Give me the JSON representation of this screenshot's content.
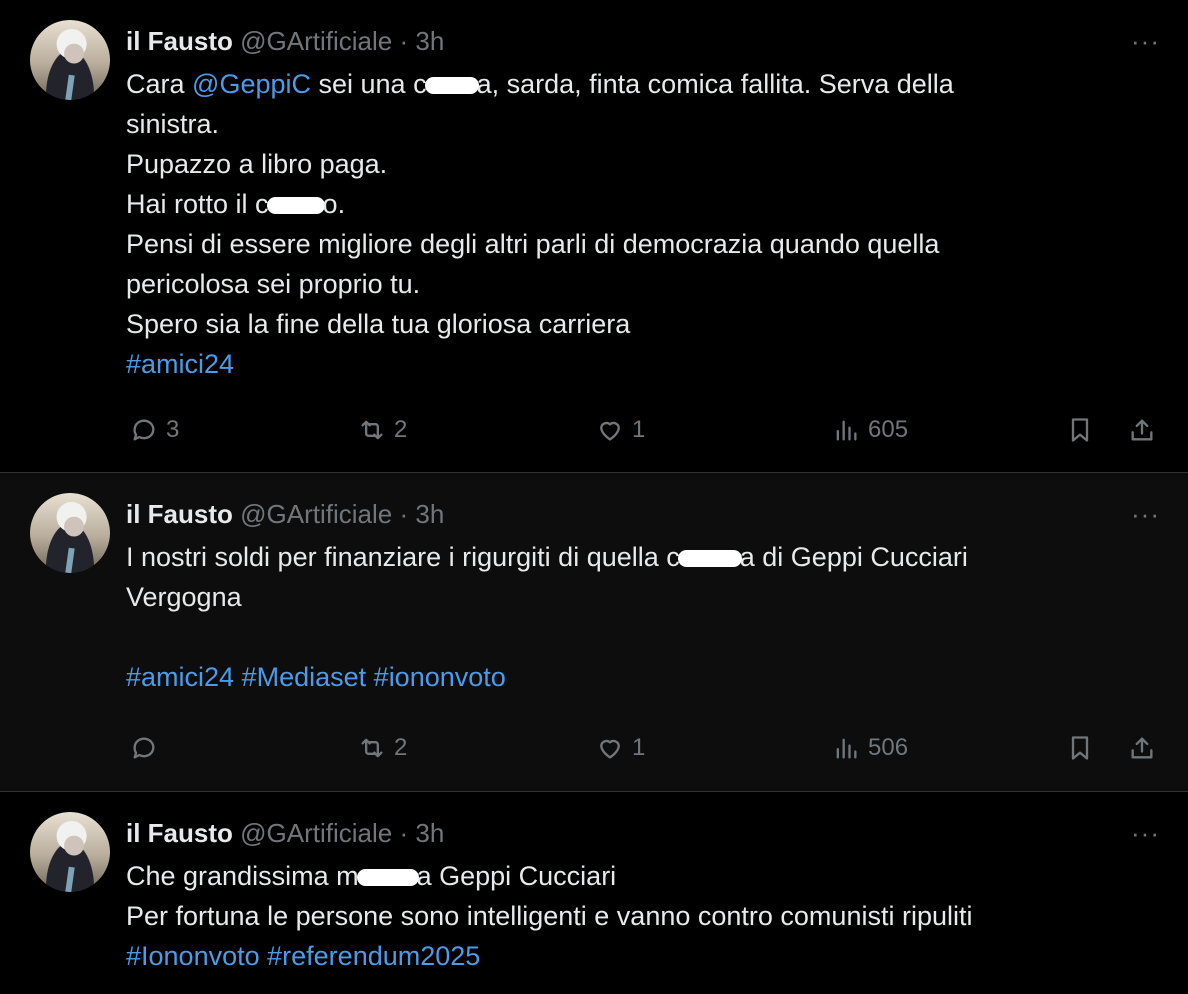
{
  "tweets": [
    {
      "name": "il Fausto",
      "handle": "@GArtificiale",
      "sep": "·",
      "time": "3h",
      "more": "···",
      "lines": [
        [
          "Cara ",
          "@GeppiC",
          " sei una c",
          "a, sarda, finta comica fallita. Serva della"
        ],
        [
          "sinistra."
        ],
        [
          "Pupazzo a libro paga."
        ],
        [
          "Hai rotto il c",
          "o."
        ],
        [
          "Pensi di essere migliore degli altri parli di  democrazia quando quella"
        ],
        [
          "pericolosa sei proprio tu."
        ],
        [
          "Spero sia la fine della tua gloriosa carriera"
        ],
        [
          "#amici24"
        ]
      ],
      "actions": {
        "replies": "3",
        "reposts": "2",
        "likes": "1",
        "views": "605"
      }
    },
    {
      "name": "il Fausto",
      "handle": "@GArtificiale",
      "sep": "·",
      "time": "3h",
      "more": "···",
      "lines": [
        [
          "I nostri soldi per finanziare i rigurgiti di quella c",
          "a di Geppi Cucciari"
        ],
        [
          "Vergogna"
        ],
        [
          ""
        ],
        [
          "#amici24",
          " ",
          "#Mediaset",
          " ",
          "#iononvoto"
        ]
      ],
      "actions": {
        "replies": "",
        "reposts": "2",
        "likes": "1",
        "views": "506"
      }
    },
    {
      "name": "il Fausto",
      "handle": "@GArtificiale",
      "sep": "·",
      "time": "3h",
      "more": "···",
      "lines": [
        [
          "Che grandissima m",
          "a Geppi Cucciari"
        ],
        [
          "Per fortuna le persone sono intelligenti e vanno contro comunisti ripuliti"
        ],
        [
          "#Iononvoto",
          " ",
          "#referendum2025"
        ]
      ]
    }
  ],
  "icons": {
    "reply": "reply-icon",
    "repost": "repost-icon",
    "like": "heart-icon",
    "views": "views-icon",
    "bookmark": "bookmark-icon",
    "share": "share-icon"
  },
  "colors": {
    "background": "#000000",
    "link": "#4b9be8",
    "muted": "#71767b",
    "text": "#e7e9ea"
  }
}
